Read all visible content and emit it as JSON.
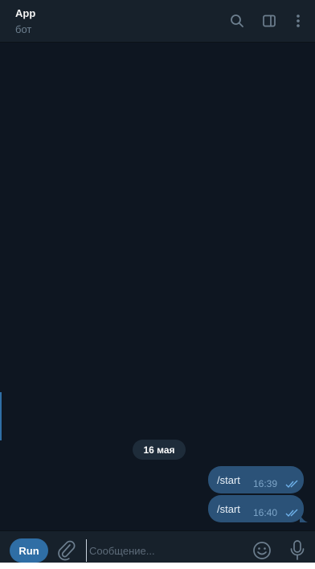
{
  "header": {
    "title": "App",
    "subtitle": "бот",
    "icons": [
      "search-icon",
      "sidebar-toggle-icon",
      "more-vertical-icon"
    ]
  },
  "chat": {
    "date_separator": "16 мая",
    "messages": [
      {
        "text": "/start",
        "time": "16:39",
        "status": "read"
      },
      {
        "text": "/start",
        "time": "16:40",
        "status": "read"
      }
    ]
  },
  "composer": {
    "run_label": "Run",
    "placeholder": "Сообщение...",
    "icons": [
      "paperclip-icon",
      "emoji-icon",
      "microphone-icon"
    ]
  },
  "colors": {
    "background": "#0e1621",
    "panel": "#17212b",
    "bubble": "#2b5278",
    "accent": "#2f6ea5",
    "tick": "#6fb1ea"
  }
}
